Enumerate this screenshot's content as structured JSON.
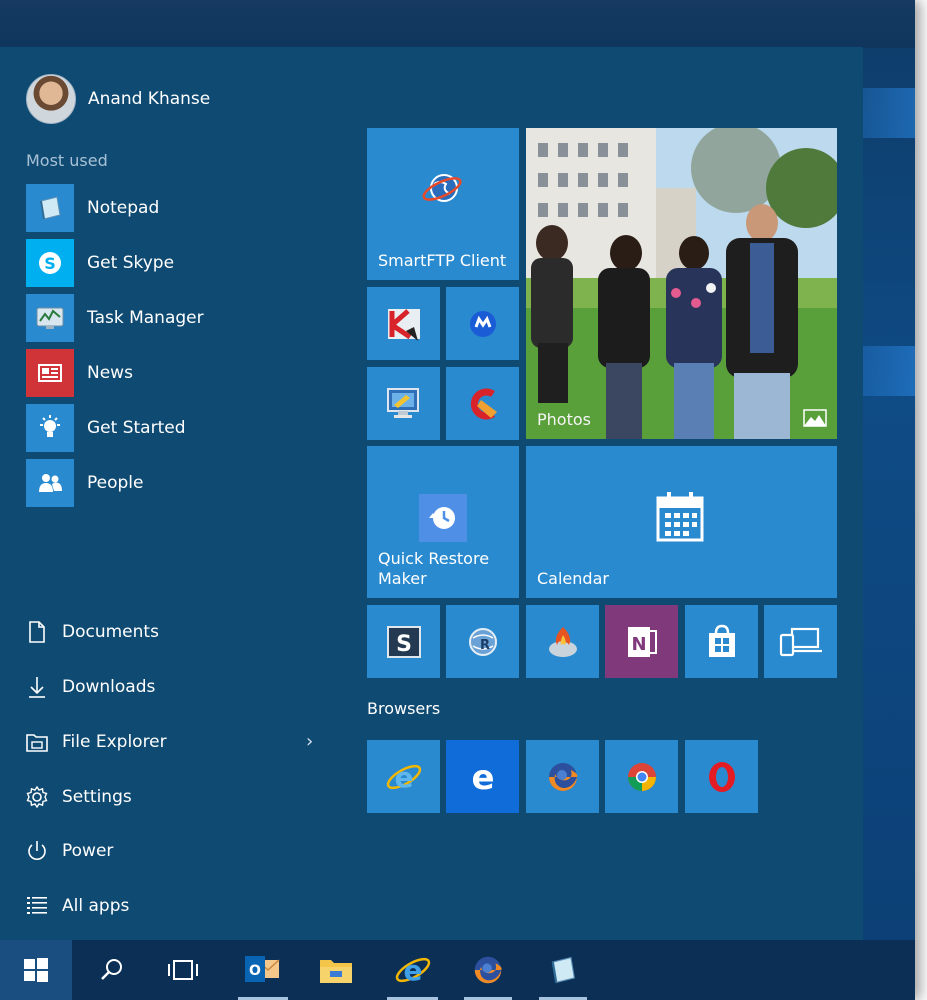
{
  "user": {
    "name": "Anand Khanse"
  },
  "most_used": {
    "label": "Most used",
    "items": [
      {
        "label": "Notepad",
        "icon": "notepad-icon",
        "color": "#2a8ad0"
      },
      {
        "label": "Get Skype",
        "icon": "skype-icon",
        "color": "#00aff0"
      },
      {
        "label": "Task Manager",
        "icon": "task-manager-icon",
        "color": "#2a8ad0"
      },
      {
        "label": "News",
        "icon": "news-icon",
        "color": "#d13438"
      },
      {
        "label": "Get Started",
        "icon": "lightbulb-icon",
        "color": "#2a8ad0"
      },
      {
        "label": "People",
        "icon": "people-icon",
        "color": "#2a8ad0"
      }
    ]
  },
  "system_items": [
    {
      "label": "Documents",
      "icon": "document-icon"
    },
    {
      "label": "Downloads",
      "icon": "download-icon"
    },
    {
      "label": "File Explorer",
      "icon": "file-explorer-icon"
    },
    {
      "label": "Settings",
      "icon": "gear-icon"
    },
    {
      "label": "Power",
      "icon": "power-icon"
    },
    {
      "label": "All apps",
      "icon": "all-apps-icon"
    }
  ],
  "tiles": {
    "smartftp": "SmartFTP Client",
    "photos": "Photos",
    "quick_restore": "Quick Restore Maker",
    "calendar": "Calendar"
  },
  "browsers": {
    "label": "Browsers"
  },
  "colors": {
    "start_bg": "#0f4a72",
    "tile": "#2a8ad0",
    "onenote": "#80397b",
    "edge": "#0f6cd8",
    "taskbar": "#0b2f55"
  }
}
